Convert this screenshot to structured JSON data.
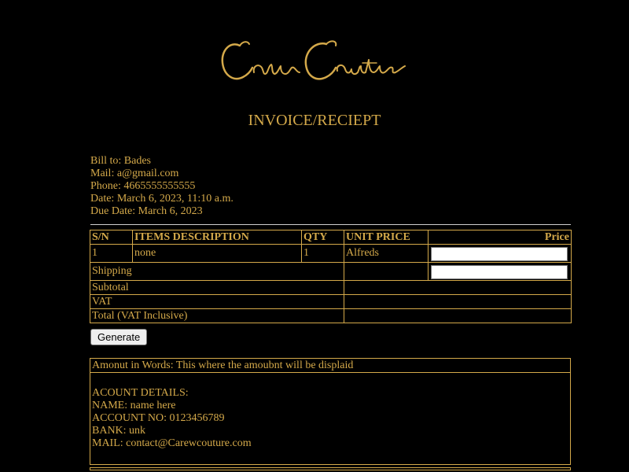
{
  "brand": {
    "logo_text": "Carew Couture",
    "accent_color": "#d4a94a",
    "background_color": "#000000"
  },
  "page": {
    "title": "INVOICE/RECIEPT"
  },
  "bill": {
    "bill_to": "Bill to: Bades",
    "mail": "Mail: a@gmail.com",
    "phone": "Phone: 4665555555555",
    "date": "Date: March 6, 2023, 11:10 a.m.",
    "due_date": "Due Date: March 6, 2023"
  },
  "table": {
    "headers": {
      "sn": "S/N",
      "description": "ITEMS DESCRIPTION",
      "qty": "QTY",
      "unit_price": "UNIT PRICE",
      "price": "Price"
    },
    "rows": [
      {
        "sn": "1",
        "description": "none",
        "qty": "1",
        "unit_price": "Alfreds",
        "price_value": ""
      }
    ],
    "shipping_label": "Shipping",
    "shipping_value": "",
    "subtotal_label": "Subtotal",
    "subtotal_value": "",
    "vat_label": "VAT",
    "vat_value": "",
    "total_label": "Total (VAT Inclusive)",
    "total_value": ""
  },
  "actions": {
    "generate_label": "Generate"
  },
  "footer": {
    "amount_words": "Amonut in Words: This where the amoubnt will be displaid",
    "account_heading": "ACOUNT DETAILS:",
    "account_name": "NAME: name here",
    "account_no": "ACCOUNT NO: 0123456789",
    "bank": "BANK: unk",
    "mail": "MAIL: contact@Carewcouture.com"
  }
}
